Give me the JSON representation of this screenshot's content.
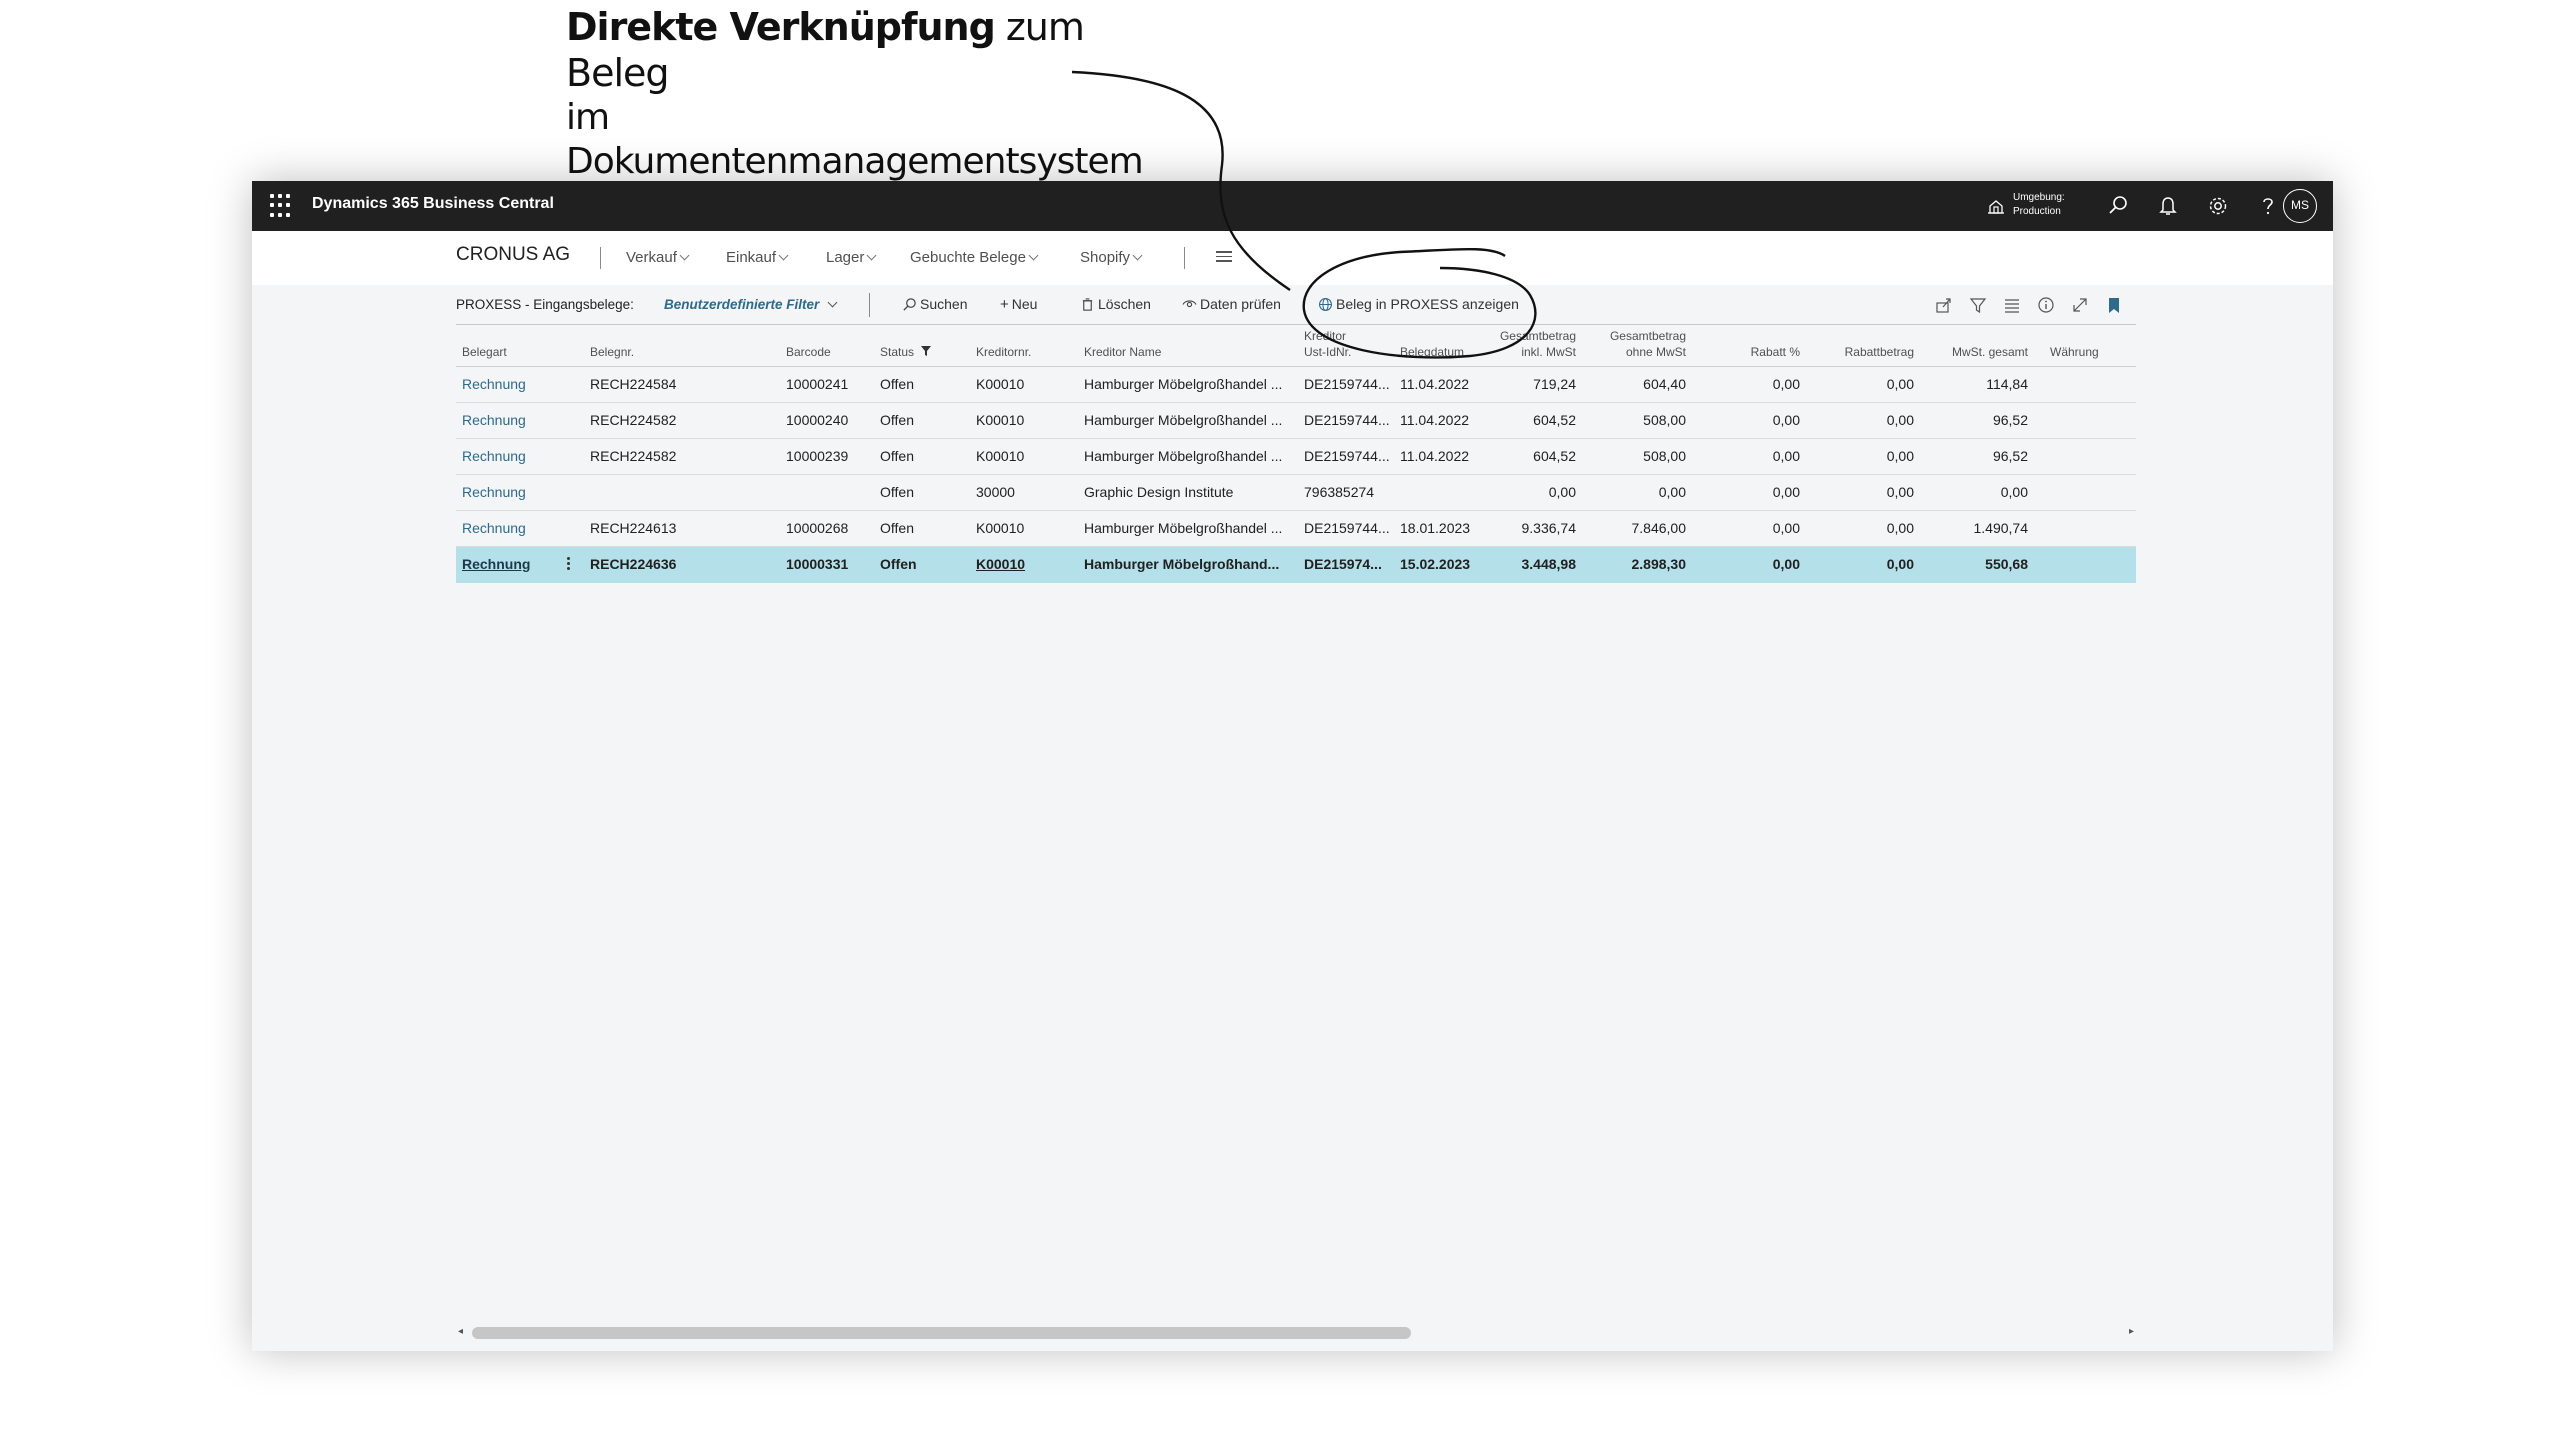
{
  "annotation": {
    "line1_bold": "Direkte Verknüpfung",
    "line1_rest": " zum Beleg",
    "line2": "im Dokumentenmanagementsystem"
  },
  "topbar": {
    "app_title": "Dynamics 365 Business Central",
    "environment_label": "Umgebung:",
    "environment_value": "Production",
    "avatar_initials": "MS",
    "icons": [
      "apps-waffle-icon",
      "environment-icon",
      "search-icon",
      "bell-icon",
      "gear-icon",
      "help-icon"
    ]
  },
  "nav": {
    "company": "CRONUS AG",
    "items": [
      {
        "label": "Verkauf"
      },
      {
        "label": "Einkauf"
      },
      {
        "label": "Lager"
      },
      {
        "label": "Gebuchte Belege"
      },
      {
        "label": "Shopify"
      }
    ]
  },
  "actions": {
    "page_title": "PROXESS - Eingangsbelege:",
    "filter_label": "Benutzerdefinierte Filter",
    "search": "Suchen",
    "new": "Neu",
    "delete": "Löschen",
    "check_data": "Daten prüfen",
    "show_in_proxess": "Beleg in PROXESS anzeigen",
    "right_icons": [
      "share-icon",
      "filter-icon",
      "list-view-icon",
      "info-icon",
      "expand-icon",
      "bookmark-icon"
    ]
  },
  "table": {
    "columns": {
      "belegart": "Belegart",
      "belegnr": "Belegnr.",
      "barcode": "Barcode",
      "status": "Status",
      "kreditornr": "Kreditornr.",
      "kreditor_name": "Kreditor Name",
      "ustid_1": "Kreditor",
      "ustid_2": "Ust-IdNr.",
      "belegdatum": "Belegdatum",
      "inkl_1": "Gesamtbetrag",
      "inkl_2": "inkl. MwSt",
      "ohne_1": "Gesamtbetrag",
      "ohne_2": "ohne MwSt",
      "rabatt_pct": "Rabatt %",
      "rabattbetrag": "Rabattbetrag",
      "mwst": "MwSt. gesamt",
      "waehrung": "Währung"
    },
    "rows": [
      {
        "belegart": "Rechnung",
        "belegnr": "RECH224584",
        "barcode": "10000241",
        "status": "Offen",
        "kreditornr": "K00010",
        "kreditor_name": "Hamburger Möbelgroßhandel ...",
        "ustid": "DE2159744...",
        "belegdatum": "11.04.2022",
        "inkl": "719,24",
        "ohne": "604,40",
        "rabatt_pct": "0,00",
        "rabattbetrag": "0,00",
        "mwst": "114,84",
        "waehrung": ""
      },
      {
        "belegart": "Rechnung",
        "belegnr": "RECH224582",
        "barcode": "10000240",
        "status": "Offen",
        "kreditornr": "K00010",
        "kreditor_name": "Hamburger Möbelgroßhandel ...",
        "ustid": "DE2159744...",
        "belegdatum": "11.04.2022",
        "inkl": "604,52",
        "ohne": "508,00",
        "rabatt_pct": "0,00",
        "rabattbetrag": "0,00",
        "mwst": "96,52",
        "waehrung": ""
      },
      {
        "belegart": "Rechnung",
        "belegnr": "RECH224582",
        "barcode": "10000239",
        "status": "Offen",
        "kreditornr": "K00010",
        "kreditor_name": "Hamburger Möbelgroßhandel ...",
        "ustid": "DE2159744...",
        "belegdatum": "11.04.2022",
        "inkl": "604,52",
        "ohne": "508,00",
        "rabatt_pct": "0,00",
        "rabattbetrag": "0,00",
        "mwst": "96,52",
        "waehrung": ""
      },
      {
        "belegart": "Rechnung",
        "belegnr": "",
        "barcode": "",
        "status": "Offen",
        "kreditornr": "30000",
        "kreditor_name": "Graphic Design Institute",
        "ustid": "796385274",
        "belegdatum": "",
        "inkl": "0,00",
        "ohne": "0,00",
        "rabatt_pct": "0,00",
        "rabattbetrag": "0,00",
        "mwst": "0,00",
        "waehrung": ""
      },
      {
        "belegart": "Rechnung",
        "belegnr": "RECH224613",
        "barcode": "10000268",
        "status": "Offen",
        "kreditornr": "K00010",
        "kreditor_name": "Hamburger Möbelgroßhandel ...",
        "ustid": "DE2159744...",
        "belegdatum": "18.01.2023",
        "inkl": "9.336,74",
        "ohne": "7.846,00",
        "rabatt_pct": "0,00",
        "rabattbetrag": "0,00",
        "mwst": "1.490,74",
        "waehrung": ""
      },
      {
        "belegart": "Rechnung",
        "belegnr": "RECH224636",
        "barcode": "10000331",
        "status": "Offen",
        "kreditornr": "K00010",
        "kreditor_name": "Hamburger Möbelgroßhand...",
        "ustid": "DE215974...",
        "belegdatum": "15.02.2023",
        "inkl": "3.448,98",
        "ohne": "2.898,30",
        "rabatt_pct": "0,00",
        "rabattbetrag": "0,00",
        "mwst": "550,68",
        "waehrung": "",
        "selected": true
      }
    ]
  },
  "scrollbar": {
    "position": 0.0,
    "visible_fraction": 0.57
  }
}
